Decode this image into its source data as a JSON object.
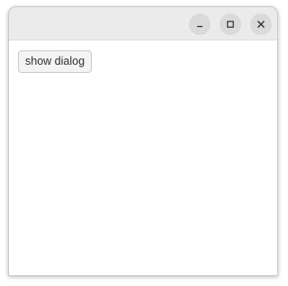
{
  "window": {
    "controls": [
      {
        "name": "minimize",
        "icon": "minimize-icon"
      },
      {
        "name": "maximize",
        "icon": "maximize-icon"
      },
      {
        "name": "close",
        "icon": "close-icon"
      }
    ]
  },
  "content": {
    "show_dialog_label": "show dialog"
  },
  "colors": {
    "titlebar": "#ebebeb",
    "control_bg": "#dadada",
    "control_glyph": "#2e2e2e",
    "button_bg": "#f4f4f4",
    "button_border": "#c9c9c9"
  }
}
